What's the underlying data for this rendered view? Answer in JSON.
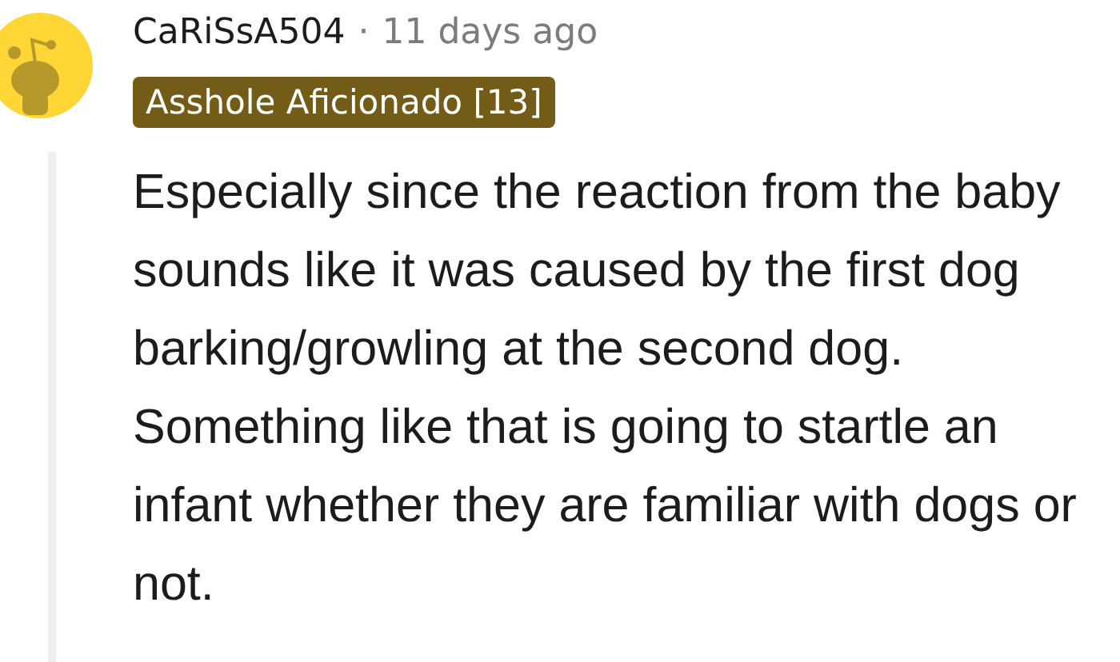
{
  "comment": {
    "author": "CaRiSsA504",
    "separator": "·",
    "time": "11 days ago",
    "flair": "Asshole Aficionado [13]",
    "body": "Especially since the reaction from the baby sounds like it was caused by the first dog barking/growling at the second dog. Something like that is going to startle an infant whether they are familiar with dogs or not."
  }
}
